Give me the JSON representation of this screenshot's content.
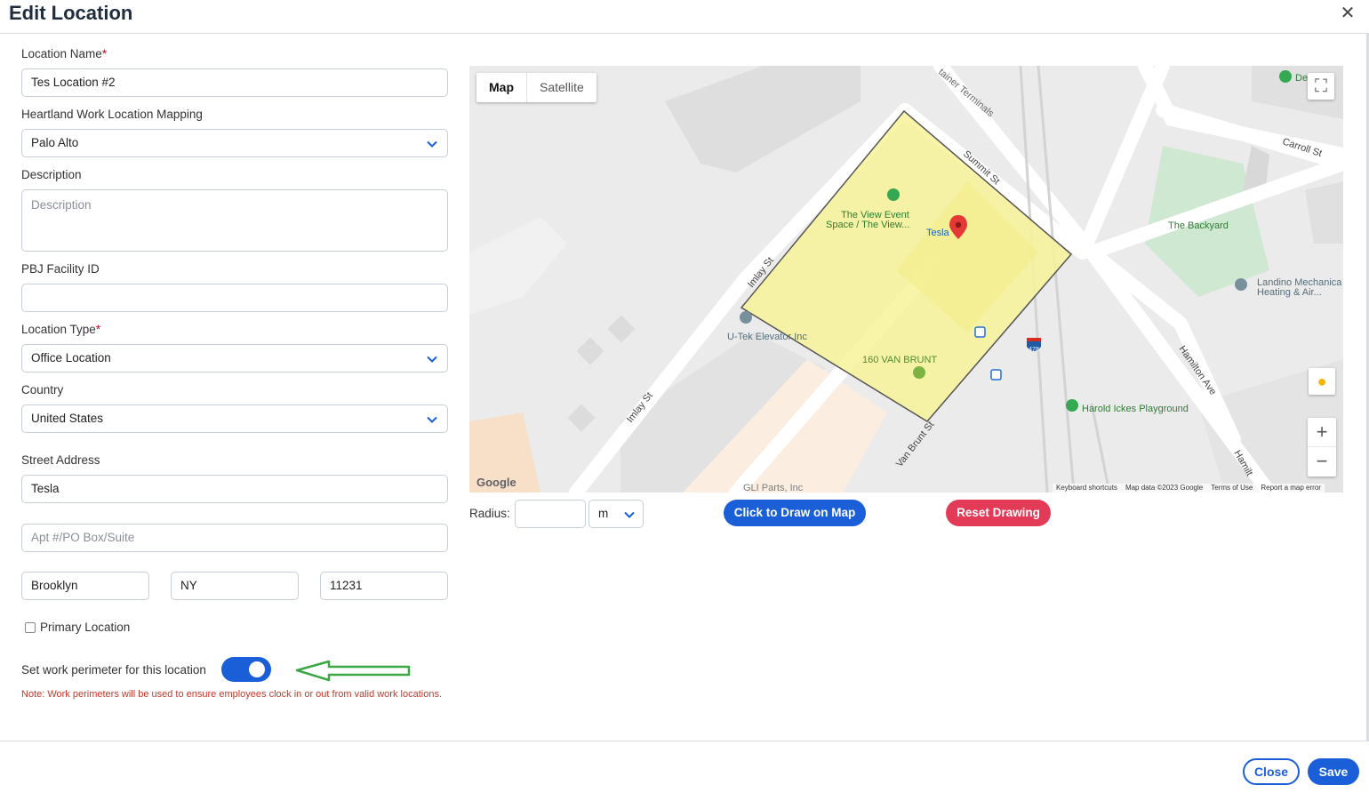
{
  "dialog": {
    "title": "Edit Location",
    "close_icon": "close-icon"
  },
  "form": {
    "location_name": {
      "label": "Location Name",
      "required_mark": "*",
      "value": "Tes Location #2"
    },
    "mapping": {
      "label": "Heartland Work Location Mapping",
      "value": "Palo Alto"
    },
    "description": {
      "label": "Description",
      "placeholder": "Description"
    },
    "pbj": {
      "label": "PBJ Facility ID",
      "value": ""
    },
    "location_type": {
      "label": "Location Type",
      "required_mark": "*",
      "value": "Office Location"
    },
    "country": {
      "label": "Country",
      "value": "United States"
    },
    "street": {
      "label": "Street Address",
      "value": "Tesla"
    },
    "apt": {
      "placeholder": "Apt #/PO Box/Suite"
    },
    "city": {
      "value": "Brooklyn"
    },
    "state": {
      "value": "NY"
    },
    "zip": {
      "value": "11231"
    },
    "primary": {
      "label": "Primary Location",
      "checked": false
    },
    "perimeter": {
      "label": "Set work perimeter for this location",
      "enabled": true
    },
    "note": "Note: Work perimeters will be used to ensure employees clock in or out from valid work locations."
  },
  "map": {
    "tabs": [
      "Map",
      "Satellite"
    ],
    "active_tab": "Map",
    "labels": {
      "tesla": "Tesla",
      "view_event_1": "The View Event",
      "view_event_2": "Space / The View...",
      "utek": "U-Tek Elevator Inc",
      "van_brunt_160": "160 VAN BRUNT",
      "backyard": "The Backyard",
      "landino_1": "Landino Mechanica",
      "landino_2": "Heating & Air...",
      "harold": "Harold Ickes Playground",
      "summit": "Summit St",
      "imlay_1": "Imlay St",
      "imlay_2": "Imlay St",
      "van_brunt_st": "Van Brunt St",
      "hamilton_1": "Hamilton Ave",
      "hamilton_2": "Hamilt",
      "carroll": "Carroll St",
      "container": "tainer Terminals",
      "gl_parts": "GLI Parts, Inc",
      "de": "De",
      "interstate": "478"
    },
    "google": "Google",
    "footer": [
      "Keyboard shortcuts",
      "Map data ©2023 Google",
      "Terms of Use",
      "Report a map error"
    ],
    "zoom_in": "+",
    "zoom_out": "−"
  },
  "radius": {
    "label": "Radius:",
    "value": "",
    "unit": "m"
  },
  "buttons": {
    "draw": "Click to Draw on Map",
    "reset": "Reset Drawing",
    "close": "Close",
    "save": "Save"
  },
  "colors": {
    "primary": "#1a5fd8",
    "danger": "#e23a57",
    "note": "#c0392b",
    "perimeter_fill": "#f7f39a"
  }
}
